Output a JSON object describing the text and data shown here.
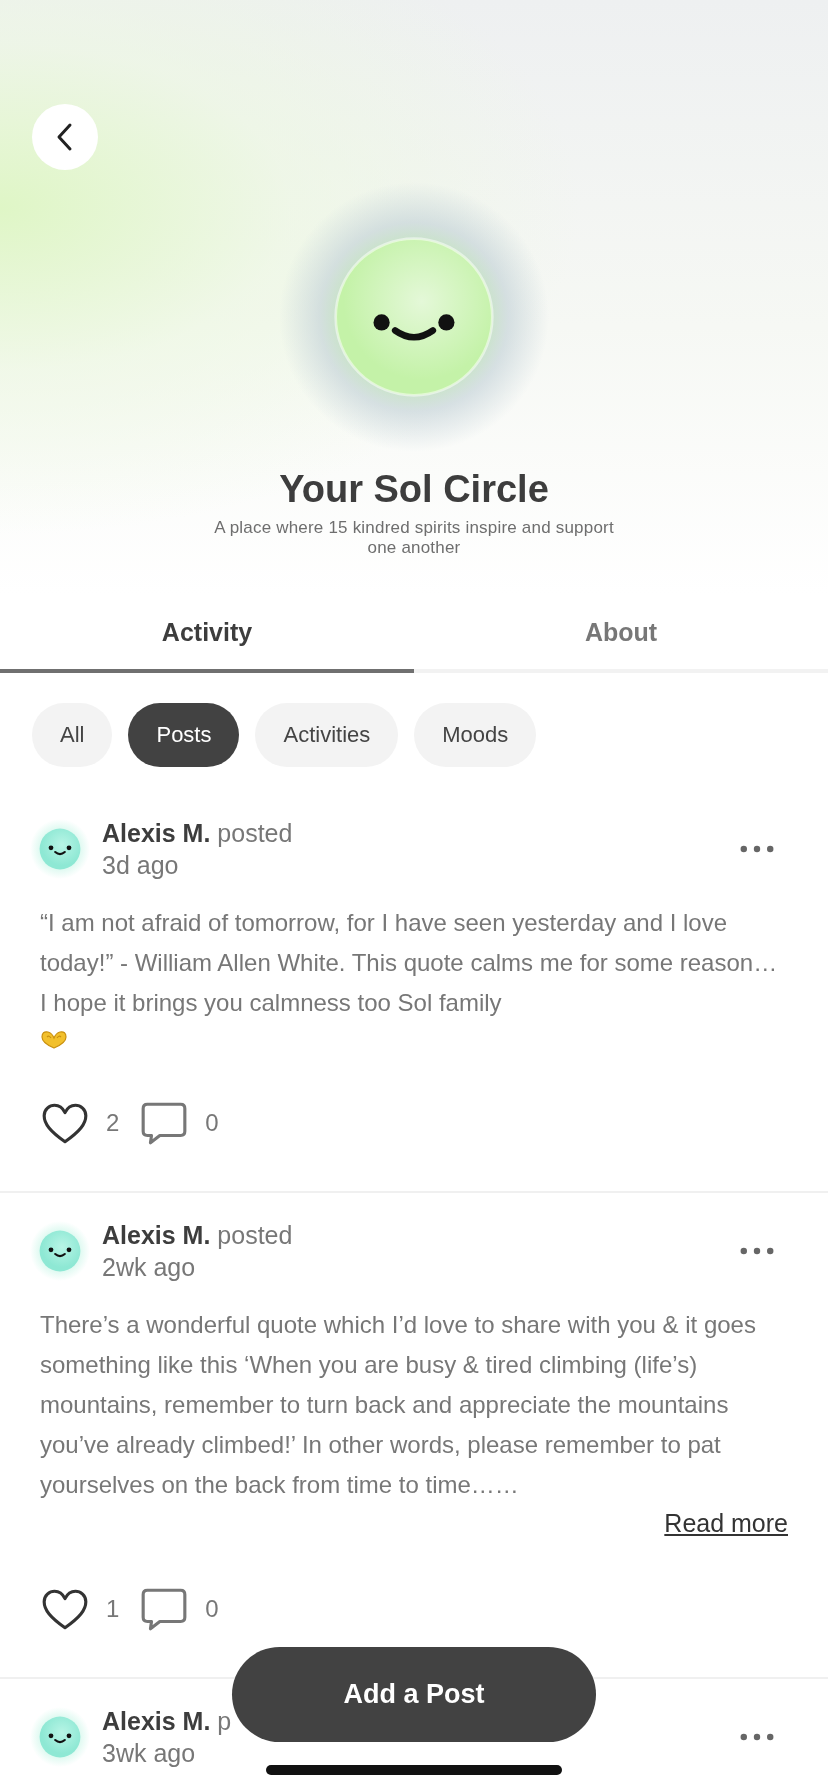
{
  "header": {
    "title": "Your Sol Circle",
    "subtitle": "A place where 15 kindred spirits inspire and support one another"
  },
  "tabs": [
    {
      "label": "Activity",
      "selected": true
    },
    {
      "label": "About",
      "selected": false
    }
  ],
  "filters": [
    {
      "label": "All",
      "selected": false
    },
    {
      "label": "Posts",
      "selected": true
    },
    {
      "label": "Activities",
      "selected": false
    },
    {
      "label": "Moods",
      "selected": false
    }
  ],
  "posts": [
    {
      "author": "Alexis M.",
      "action": "posted",
      "time": "3d ago",
      "body": "“I am not afraid of tomorrow, for I have seen yesterday and I love today!” - William Allen White. This quote calms me for some reason… I hope it brings you calmness too Sol family",
      "heart_hands_emoji": true,
      "likes": "2",
      "comments": "0"
    },
    {
      "author": "Alexis M.",
      "action": "posted",
      "time": "2wk ago",
      "body": "There’s a wonderful quote which I’d love to share with you & it goes something like this ‘When you are busy & tired climbing (life’s) mountains, remember to turn back and appreciate the mountains you’ve already climbed!’ In other words, please remember to pat yourselves on the back from time to time……",
      "read_more": "Read more",
      "likes": "1",
      "comments": "0"
    },
    {
      "author": "Alexis M.",
      "action": "p",
      "time": "3wk ago"
    }
  ],
  "add_button": "Add a Post"
}
